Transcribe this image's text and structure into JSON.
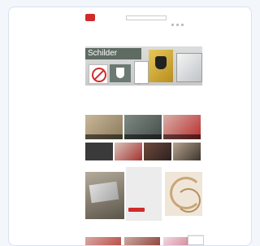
{
  "topbar": {
    "left_text": "",
    "items": [
      "",
      "",
      ""
    ]
  },
  "header": {
    "logo_text": "",
    "search_placeholder": "",
    "cart_label": ""
  },
  "nav": {
    "items": [
      "",
      "",
      "",
      "",
      "",
      "",
      ""
    ],
    "sub_item": ""
  },
  "hero": {
    "title": "Schilder",
    "dots": "• • •"
  },
  "section": {
    "title": "",
    "subtitle": ""
  },
  "tiles": [
    "",
    "",
    ""
  ],
  "promo": {
    "title": "",
    "text": "",
    "button": ""
  },
  "section2": {
    "title": ""
  },
  "colors": {
    "brand": "#d12b2b",
    "hero_label_bg": "#5e6b63",
    "promo_bg": "#ececec"
  }
}
